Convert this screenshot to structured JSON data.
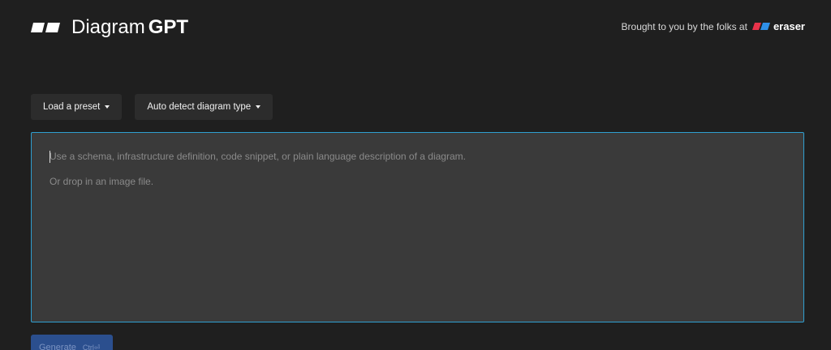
{
  "header": {
    "logo_icon": "diagramgpt-logo-icon",
    "logo_light": "Diagram",
    "logo_bold": "GPT",
    "credit_text": "Brought to you by the folks at",
    "credit_brand": "eraser",
    "credit_brand_icon": "eraser-logo-icon"
  },
  "toolbar": {
    "preset_label": "Load a preset",
    "diagram_type_label": "Auto detect diagram type",
    "caret_icon": "caret-down-icon"
  },
  "editor": {
    "placeholder_line1": "Use a schema, infrastructure definition, code snippet, or plain language description of a diagram.",
    "placeholder_line2": "Or drop in an image file.",
    "border_color": "#2f9fd0",
    "background_color": "#3a3a3a"
  },
  "generate": {
    "label": "Generate",
    "shortcut": "Ctrl⏎",
    "background_color": "#2b4f8e"
  },
  "colors": {
    "page_background": "#1f1f1f",
    "eraser_red": "#e8334a",
    "eraser_blue": "#2f8fe8"
  }
}
